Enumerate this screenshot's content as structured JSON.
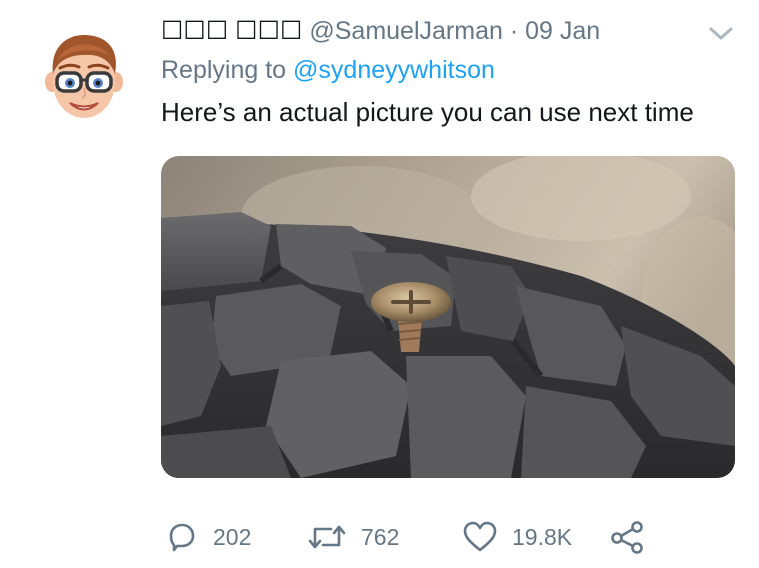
{
  "tweet": {
    "display_name": "☐☐☐ ☐☐☐",
    "handle": "@SamuelJarman",
    "separator": "·",
    "date": "09 Jan",
    "replying_prefix": "Replying to",
    "replying_to": "@sydneyywhitson",
    "text": "Here’s an actual picture you can use next time",
    "media": {
      "description": "tire-with-screw-photo"
    }
  },
  "actions": {
    "replies": "202",
    "retweets": "762",
    "likes": "19.8K"
  },
  "icons": {
    "reply": "reply-icon",
    "retweet": "retweet-icon",
    "like": "heart-icon",
    "share": "share-icon",
    "menu": "chevron-down-icon"
  },
  "colors": {
    "accent": "#1da1f2",
    "muted": "#657786",
    "text": "#14171a"
  }
}
